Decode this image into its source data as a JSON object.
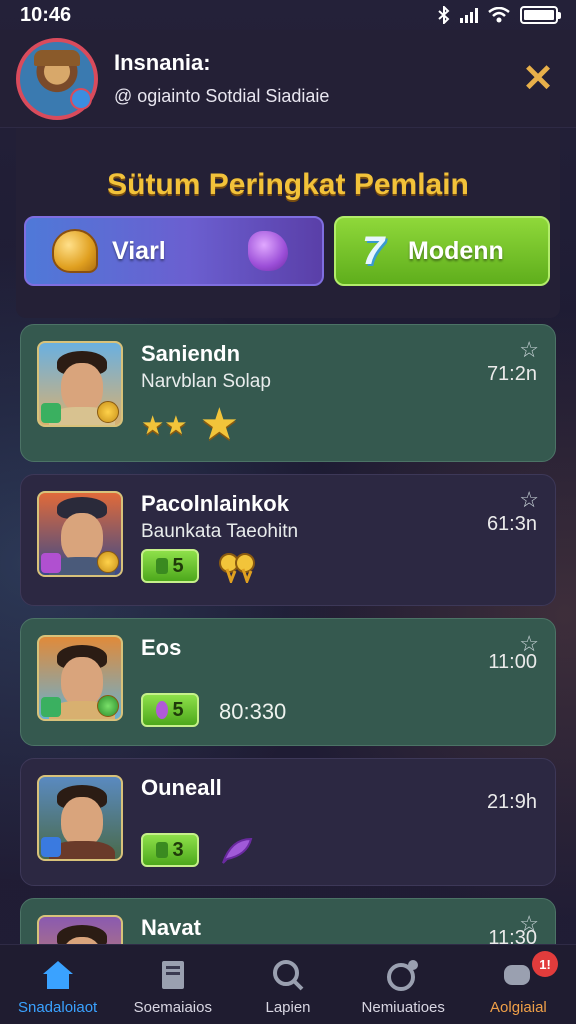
{
  "status_bar": {
    "time": "10:46"
  },
  "header": {
    "username": "Insnania:",
    "subtitle": "@ ogiainto Sotdial Siadiaie",
    "close_icon": "close-icon"
  },
  "title": "Sütum Peringkat Pemlain",
  "tabs": [
    {
      "label": "Viarl",
      "icon": "helmet-icon",
      "gem_icon": "gem-icon",
      "color": "#6b5fd0"
    },
    {
      "label": "Modenn",
      "icon": "bolt-icon",
      "color": "#6cc02a"
    }
  ],
  "players": [
    {
      "name": "Saniendn",
      "subtitle": "Narvblan Solap",
      "time": "71:2n",
      "rating": 3,
      "theme": "green"
    },
    {
      "name": "Pacolnlainkok",
      "subtitle": "Baunkata Taeohitn",
      "time": "61:3n",
      "chip": "5",
      "theme": "purple"
    },
    {
      "name": "Eos",
      "time": "11:00",
      "chip": "5",
      "score": "80:330",
      "theme": "green"
    },
    {
      "name": "Ouneall",
      "time": "21:9h",
      "chip": "3",
      "theme": "purple"
    },
    {
      "name": "Navat",
      "time": "11:30",
      "theme": "green"
    }
  ],
  "nav": [
    {
      "label": "Snadaloiaot",
      "icon": "home-icon"
    },
    {
      "label": "Soemaiaios",
      "icon": "book-icon"
    },
    {
      "label": "Lapien",
      "icon": "search-icon"
    },
    {
      "label": "Nemiuatioes",
      "icon": "medal-icon"
    },
    {
      "label": "Aolgiaial",
      "icon": "chat-icon",
      "badge": "1!"
    }
  ],
  "colors": {
    "accent": "#3aa2ff",
    "title": "#f2c23a",
    "close": "#e8b04a"
  }
}
